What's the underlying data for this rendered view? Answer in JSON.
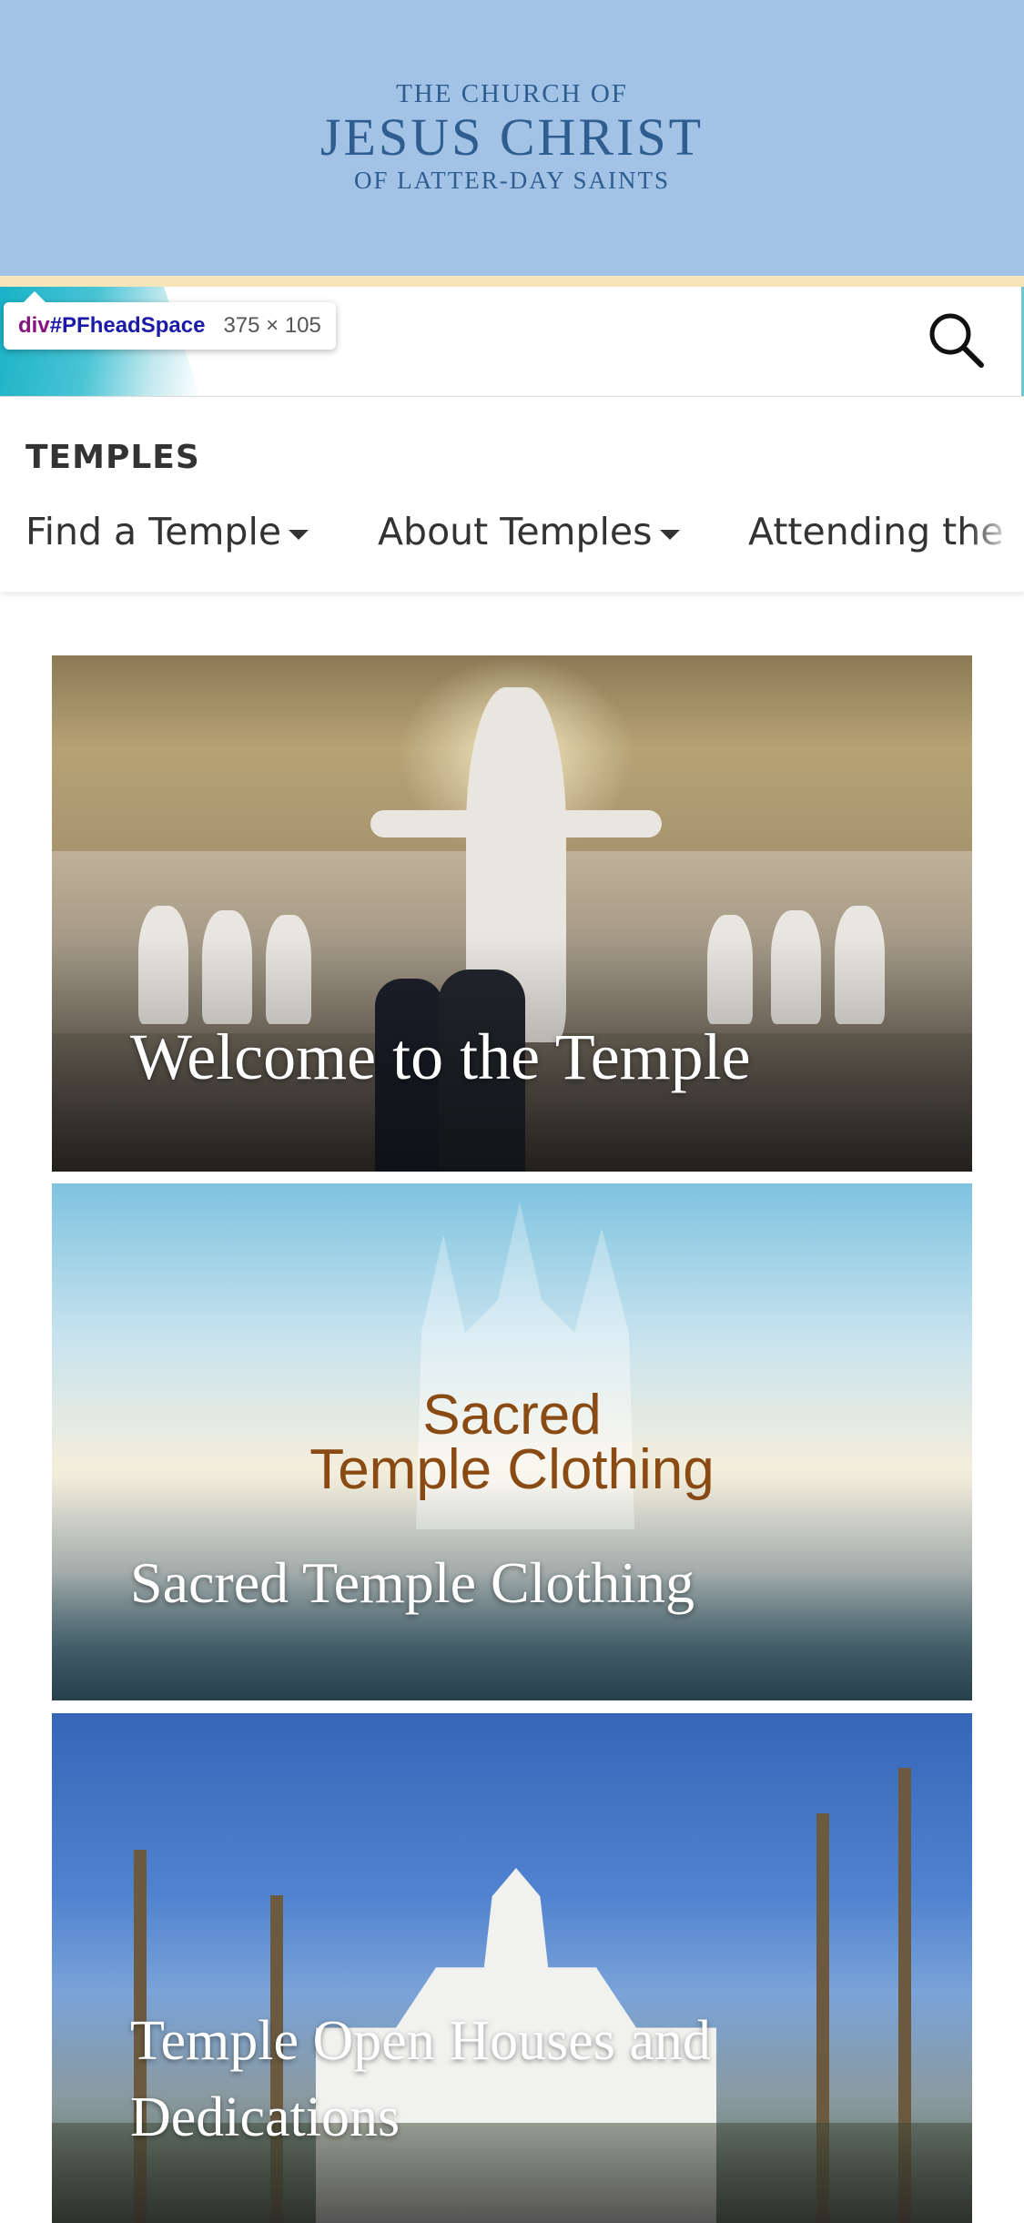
{
  "logo": {
    "line1": "THE CHURCH OF",
    "line2": "JESUS CHRIST",
    "line3": "OF LATTER-DAY SAINTS"
  },
  "inspector_tooltip": {
    "tag": "div",
    "id": "#PFheadSpace",
    "dimensions": "375 × 105"
  },
  "section": {
    "title": "TEMPLES",
    "nav": [
      {
        "label": "Find a Temple"
      },
      {
        "label": "About Temples"
      },
      {
        "label": "Attending the T"
      }
    ]
  },
  "cards": [
    {
      "title": "Welcome to the Temple"
    },
    {
      "title": "Sacred Temple Clothing",
      "image_text_1": "Sacred",
      "image_text_2": "Temple Clothing"
    },
    {
      "title": "Temple Open Houses and Dedications"
    }
  ],
  "colors": {
    "header_blue": "#a2c2e6",
    "accent_teal": "#19b2c7",
    "gold_line": "#f6e5b8"
  },
  "icons": [
    "search-icon",
    "caret-down-icon"
  ]
}
